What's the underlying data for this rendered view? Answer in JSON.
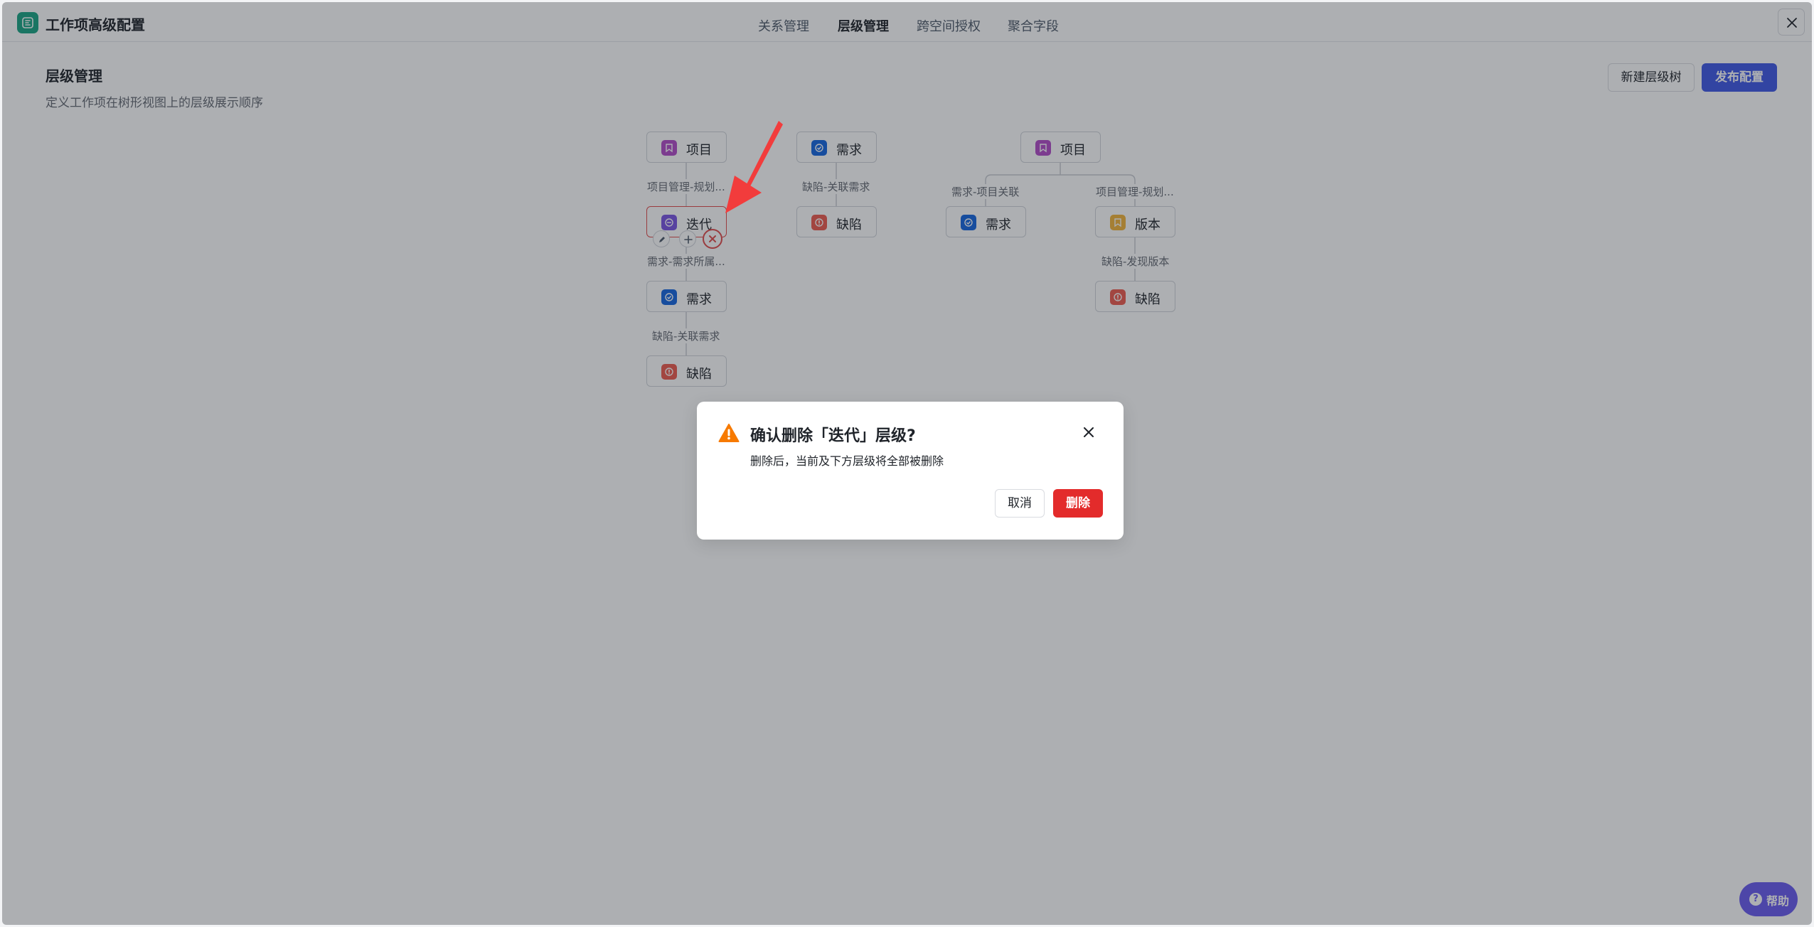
{
  "header": {
    "title": "工作项高级配置",
    "tabs": [
      "关系管理",
      "层级管理",
      "跨空间授权",
      "聚合字段"
    ],
    "active_tab": "层级管理"
  },
  "page": {
    "title": "层级管理",
    "description": "定义工作项在树形视图上的层级展示顺序",
    "new_tree_label": "新建层级树",
    "publish_label": "发布配置"
  },
  "tree1": {
    "n1": "项目",
    "r1": "项目管理-规划...",
    "n2": "迭代",
    "r2": "需求-需求所属...",
    "n3": "需求",
    "r3": "缺陷-关联需求",
    "n4": "缺陷"
  },
  "tree2": {
    "n1": "需求",
    "r1": "缺陷-关联需求",
    "n2": "缺陷"
  },
  "tree3": {
    "root": "项目",
    "r_left": "需求-项目关联",
    "r_right": "项目管理-规划...",
    "left": "需求",
    "right": "版本",
    "r_right2": "缺陷-发现版本",
    "right2": "缺陷"
  },
  "dialog": {
    "title": "确认删除「迭代」层级?",
    "description": "删除后，当前及下方层级将全部被删除",
    "cancel_label": "取消",
    "delete_label": "删除"
  },
  "help": {
    "label": "帮助",
    "mark": "?"
  },
  "colors": {
    "brand": "#1aa584",
    "primary": "#3f58e6",
    "danger": "#e32b2b",
    "warning": "#f77a00",
    "annotation_arrow": "#f23c3c"
  }
}
